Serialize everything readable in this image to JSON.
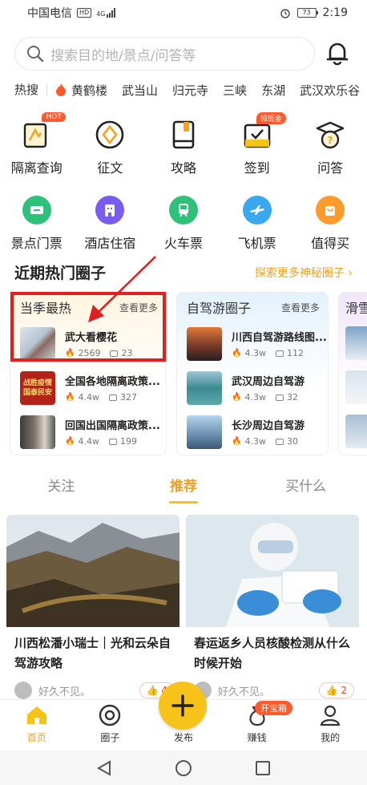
{
  "status_bar": {
    "carrier": "中国电信",
    "network": "HD",
    "signal": "4G",
    "battery": "73",
    "time": "2:19"
  },
  "search": {
    "placeholder": "搜索目的地/景点/问答等"
  },
  "hot_search": {
    "label": "热搜",
    "items": [
      "黄鹤楼",
      "武当山",
      "归元寺",
      "三峡",
      "东湖",
      "武汉欢乐谷"
    ]
  },
  "grid_row1": [
    {
      "label": "隔离查询",
      "icon": "isolation-query-icon",
      "badge": "HOT"
    },
    {
      "label": "征文",
      "icon": "essay-icon"
    },
    {
      "label": "攻略",
      "icon": "guide-icon"
    },
    {
      "label": "签到",
      "icon": "checkin-icon",
      "badge": "领现金"
    },
    {
      "label": "问答",
      "icon": "qa-icon"
    }
  ],
  "grid_row2": [
    {
      "label": "景点门票",
      "icon": "ticket-icon",
      "color": "#2fc07a"
    },
    {
      "label": "酒店住宿",
      "icon": "hotel-icon",
      "color": "#7a5cf0"
    },
    {
      "label": "火车票",
      "icon": "train-icon",
      "color": "#2fc07a"
    },
    {
      "label": "飞机票",
      "icon": "plane-icon",
      "color": "#3aa8f0"
    },
    {
      "label": "值得买",
      "icon": "shopping-bag-icon",
      "color": "#ff9a2c"
    }
  ],
  "circles_section": {
    "title": "近期热门圈子",
    "more": "探索更多神秘圈子"
  },
  "cards": [
    {
      "title": "当季最热",
      "more": "查看更多",
      "items": [
        {
          "name": "武大看樱花",
          "heat": "2569",
          "comments": "23"
        },
        {
          "name": "全国各地隔离政策...",
          "heat": "4.4w",
          "comments": "327"
        },
        {
          "name": "回国出国隔离政策...",
          "heat": "4.4w",
          "comments": "199"
        }
      ]
    },
    {
      "title": "自驾游圈子",
      "more": "查看更多",
      "items": [
        {
          "name": "川西自驾游路线图...",
          "heat": "4.3w",
          "comments": "112"
        },
        {
          "name": "武汉周边自驾游",
          "heat": "4.3w",
          "comments": "32"
        },
        {
          "name": "长沙周边自驾游",
          "heat": "4.3w",
          "comments": "30"
        }
      ]
    },
    {
      "title": "滑雪"
    }
  ],
  "thumb_text": "战胜疫情\n国泰民安",
  "tabs": [
    "关注",
    "推荐",
    "买什么"
  ],
  "feed": [
    {
      "title": "川西松潘小瑞士｜光和云朵自驾游攻略",
      "author": "好久不见。",
      "likes": "4"
    },
    {
      "title": "春运返乡人员核酸检测从什么时候开始",
      "author": "好久不见。",
      "likes": "2"
    }
  ],
  "bottom_nav": {
    "home": "首页",
    "circle": "圈子",
    "publish": "发布",
    "earn": "赚钱",
    "earn_badge": "开宝箱",
    "mine": "我的"
  },
  "colors": {
    "accent": "#f7c21a",
    "accent_text": "#f0a020",
    "highlight_box": "#e02020"
  }
}
